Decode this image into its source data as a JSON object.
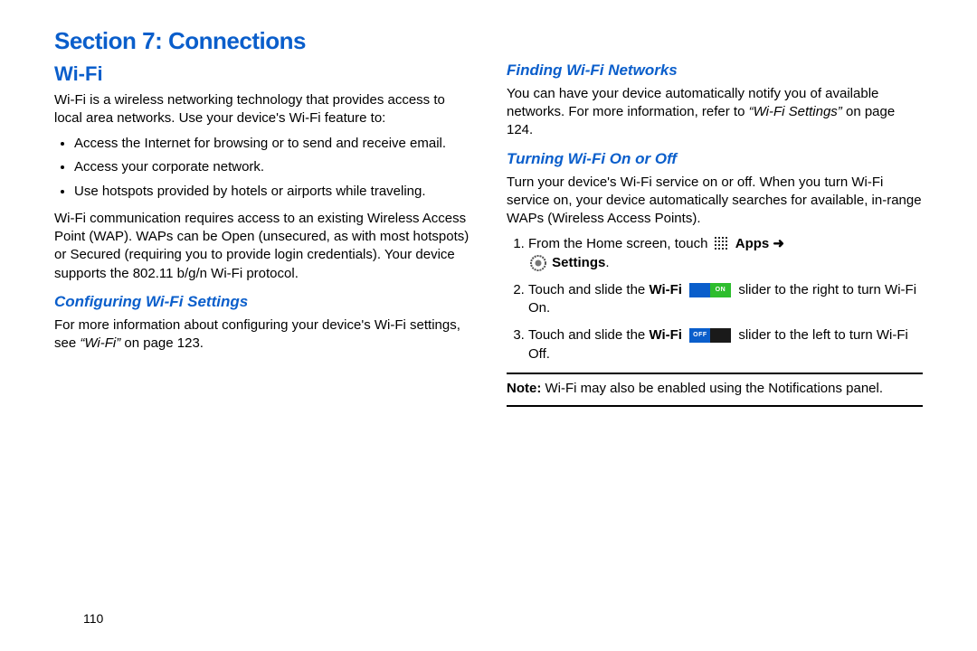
{
  "section_title": "Section 7: Connections",
  "page_number": "110",
  "left": {
    "heading": "Wi-Fi",
    "intro": "Wi-Fi is a wireless networking technology that provides access to local area networks. Use your device's Wi-Fi feature to:",
    "bullets": [
      "Access the Internet for browsing or to send and receive email.",
      "Access your corporate network.",
      "Use hotspots provided by hotels or airports while traveling."
    ],
    "wap_para": "Wi-Fi communication requires access to an existing Wireless Access Point (WAP). WAPs can be Open (unsecured, as with most hotspots) or Secured (requiring you to provide login credentials). Your device supports the 802.11 b/g/n Wi-Fi protocol.",
    "config_heading": "Configuring Wi-Fi Settings",
    "config_para_a": "For more information about configuring your device's Wi-Fi settings, see ",
    "config_ref": "“Wi-Fi”",
    "config_para_b": " on page 123."
  },
  "right": {
    "finding_heading": "Finding Wi-Fi Networks",
    "finding_para_a": "You can have your device automatically notify you of available networks. For more information, refer to ",
    "finding_ref": "“Wi-Fi Settings”",
    "finding_para_b": "  on page 124.",
    "turning_heading": "Turning Wi-Fi On or Off",
    "turning_intro": "Turn your device's Wi-Fi service on or off. When you turn Wi-Fi service on, your device automatically searches for available, in-range WAPs (Wireless Access Points).",
    "step1_a": "From the Home screen, touch ",
    "step1_apps": "Apps",
    "step1_arrow": " ➜ ",
    "step1_settings": "Settings",
    "step1_end": ".",
    "step2_a": "Touch and slide the ",
    "step2_wifi": "Wi-Fi",
    "step2_b": " slider to the right to turn Wi-Fi On.",
    "step3_a": "Touch and slide the ",
    "step3_wifi": "Wi-Fi",
    "step3_b": " slider to the left to turn Wi-Fi Off.",
    "note_label": "Note:",
    "note_text": " Wi-Fi may also be enabled using the Notifications panel."
  }
}
